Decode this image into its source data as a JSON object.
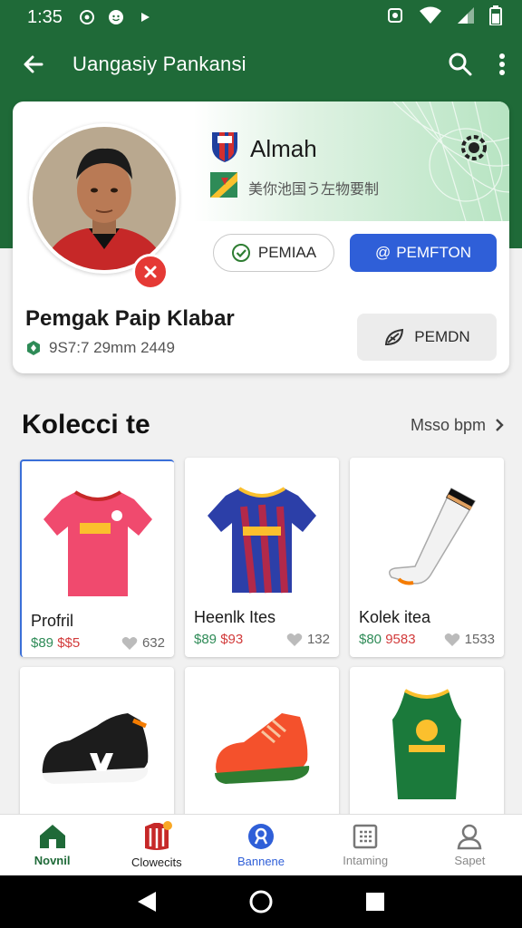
{
  "status_bar": {
    "time": "1:35"
  },
  "app_bar": {
    "title": "Uangasiy Pankansi",
    "back_icon": "arrow-left-icon",
    "search_icon": "search-icon",
    "menu_icon": "more-vert-icon"
  },
  "profile": {
    "club_name": "Almah",
    "club_subtitle": "美你池国う左物要制",
    "name": "Pemgak Paip Klabar",
    "meta": "9S7:7 29mm 2449",
    "btn_outline": "PEMIAA",
    "btn_primary": "PEMFTON",
    "btn_grey": "PEMDN"
  },
  "collection": {
    "title": "Kolecci te",
    "see_more": "Msso bpm",
    "items": [
      {
        "name": "Profril",
        "price_a": "$89",
        "price_b": "$$5",
        "likes": "632"
      },
      {
        "name": "Heenlk Ites",
        "price_a": "$89",
        "price_b": "$93",
        "likes": "132"
      },
      {
        "name": "Kolek itea",
        "price_a": "$80",
        "price_b": "9583",
        "likes": "1533"
      },
      {
        "name": "",
        "price_a": "",
        "price_b": "",
        "likes": ""
      },
      {
        "name": "",
        "price_a": "",
        "price_b": "",
        "likes": ""
      },
      {
        "name": "",
        "price_a": "",
        "price_b": "",
        "likes": ""
      }
    ]
  },
  "bottom_nav": [
    {
      "label": "Novnil",
      "icon": "home-icon"
    },
    {
      "label": "Clowecits",
      "icon": "jersey-icon"
    },
    {
      "label": "Bannene",
      "icon": "discover-icon"
    },
    {
      "label": "Intaming",
      "icon": "calendar-icon"
    },
    {
      "label": "Sapet",
      "icon": "profile-icon"
    }
  ],
  "colors": {
    "primary_green": "#1f6a38",
    "accent_blue": "#2f5fd8",
    "alert_red": "#e53935"
  }
}
